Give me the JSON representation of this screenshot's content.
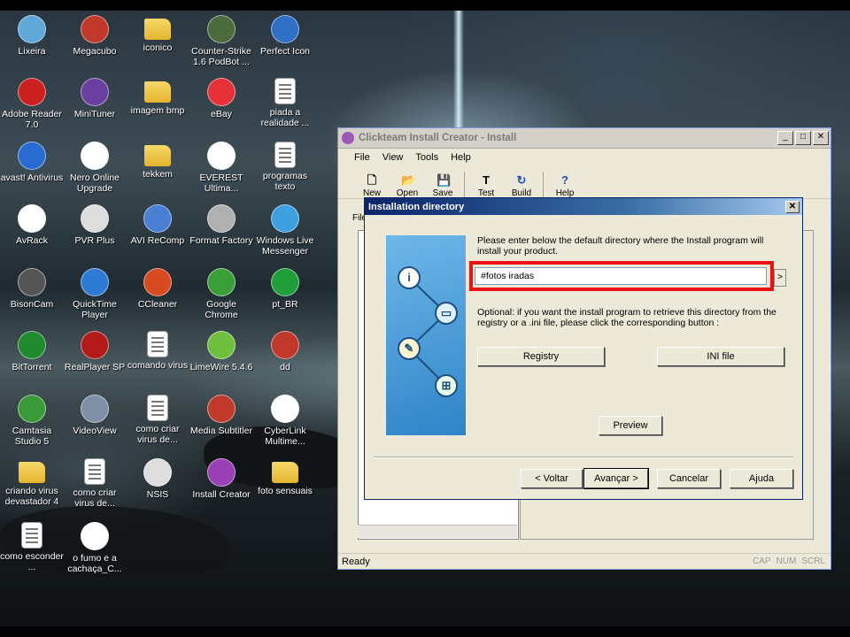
{
  "desktop": {
    "icons": [
      {
        "label": "Lixeira",
        "icon": "recycle-bin-icon",
        "color": "#5fa8d8"
      },
      {
        "label": "Megacubo",
        "icon": "megacubo-icon",
        "color": "#c0392b"
      },
      {
        "label": "iconico",
        "icon": "folder-icon",
        "color": "#e3b42c"
      },
      {
        "label": "Counter-Strike 1.6 PodBot ...",
        "icon": "counter-strike-icon",
        "color": "#4d6b3c"
      },
      {
        "label": "Perfect Icon",
        "icon": "perfect-icon-icon",
        "color": "#2f6fc5"
      },
      {
        "label": "Adobe Reader 7.0",
        "icon": "adobe-reader-icon",
        "color": "#cc1f1f"
      },
      {
        "label": "MiniTuner",
        "icon": "minituner-icon",
        "color": "#6b3fa0"
      },
      {
        "label": "imagem bmp",
        "icon": "folder-icon",
        "color": "#e3b42c"
      },
      {
        "label": "eBay",
        "icon": "ebay-icon",
        "color": "#e53238"
      },
      {
        "label": "piada a realidade ...",
        "icon": "document-icon",
        "color": "#ffffff"
      },
      {
        "label": "avast! Antivirus",
        "icon": "avast-icon",
        "color": "#2a6bd1"
      },
      {
        "label": "Nero Online Upgrade",
        "icon": "nero-icon",
        "color": "#ffffff"
      },
      {
        "label": "tekkem",
        "icon": "folder-icon",
        "color": "#e3b42c"
      },
      {
        "label": "EVEREST Ultima...",
        "icon": "everest-icon",
        "color": "#ffffff"
      },
      {
        "label": "programas texto",
        "icon": "document-icon",
        "color": "#ffffff"
      },
      {
        "label": "AvRack",
        "icon": "avrack-icon",
        "color": "#ffffff"
      },
      {
        "label": "PVR Plus",
        "icon": "pvr-plus-icon",
        "color": "#dddddd"
      },
      {
        "label": "AVI ReComp",
        "icon": "avi-recomp-icon",
        "color": "#4a7fd4"
      },
      {
        "label": "Format Factory",
        "icon": "format-factory-icon",
        "color": "#b0b0b0"
      },
      {
        "label": "Windows Live Messenger",
        "icon": "messenger-icon",
        "color": "#3fa0e0"
      },
      {
        "label": "BisonCam",
        "icon": "bisoncam-icon",
        "color": "#555555"
      },
      {
        "label": "QuickTime Player",
        "icon": "quicktime-icon",
        "color": "#2e7bd6"
      },
      {
        "label": "CCleaner",
        "icon": "ccleaner-icon",
        "color": "#d84a1f"
      },
      {
        "label": "Google Chrome",
        "icon": "chrome-icon",
        "color": "#3a9f3a"
      },
      {
        "label": "pt_BR",
        "icon": "brazil-flag-icon",
        "color": "#1f9e3a"
      },
      {
        "label": "BitTorrent",
        "icon": "bittorrent-icon",
        "color": "#1f8a2e"
      },
      {
        "label": "RealPlayer SP",
        "icon": "realplayer-icon",
        "color": "#b31b1b"
      },
      {
        "label": "comando virus",
        "icon": "document-icon",
        "color": "#ffffff"
      },
      {
        "label": "LimeWire 5.4.6",
        "icon": "limewire-icon",
        "color": "#6fbf3f"
      },
      {
        "label": "dd",
        "icon": "dd-icon",
        "color": "#c0392b"
      },
      {
        "label": "Camtasia Studio 5",
        "icon": "camtasia-icon",
        "color": "#3a9a3a"
      },
      {
        "label": "VideoView",
        "icon": "videoview-icon",
        "color": "#7f8fa6"
      },
      {
        "label": "como criar virus de...",
        "icon": "document-icon",
        "color": "#ffffff"
      },
      {
        "label": "Media Subtitler",
        "icon": "media-subtitler-icon",
        "color": "#c0392b"
      },
      {
        "label": "CyberLink Multime...",
        "icon": "cyberlink-icon",
        "color": "#ffffff"
      },
      {
        "label": "criando virus devastador 4",
        "icon": "folder-icon",
        "color": "#e3b42c"
      },
      {
        "label": "como criar virus de...",
        "icon": "document-icon",
        "color": "#ffffff"
      },
      {
        "label": "NSIS",
        "icon": "nsis-icon",
        "color": "#dddddd"
      },
      {
        "label": "Install Creator",
        "icon": "install-creator-icon",
        "color": "#9b3fb5"
      },
      {
        "label": "foto sensuais",
        "icon": "folder-icon",
        "color": "#e3b42c"
      },
      {
        "label": "como esconder ...",
        "icon": "document-icon",
        "color": "#ffffff"
      },
      {
        "label": "o fumo e a cachaça_C...",
        "icon": "wmv-file-icon",
        "color": "#ffffff"
      }
    ]
  },
  "window": {
    "title": "Clickteam Install Creator - Install",
    "controls": {
      "minimize": "_",
      "maximize": "□",
      "close": "✕"
    },
    "menu": [
      "File",
      "View",
      "Tools",
      "Help"
    ],
    "toolbar": [
      {
        "label": "New",
        "icon": "new-document-icon",
        "glyph": "🗋"
      },
      {
        "label": "Open",
        "icon": "open-folder-icon",
        "glyph": "📂"
      },
      {
        "label": "Save",
        "icon": "save-disk-icon",
        "glyph": "💾"
      },
      {
        "label": "Test",
        "icon": "test-icon",
        "glyph": "T"
      },
      {
        "label": "Build",
        "icon": "build-icon",
        "glyph": "↻"
      },
      {
        "label": "Help",
        "icon": "help-icon",
        "glyph": "?"
      }
    ],
    "partial_tab_label": "File",
    "status": {
      "text": "Ready",
      "cap": "CAP",
      "num": "NUM",
      "scrl": "SCRL"
    }
  },
  "dialog": {
    "title": "Installation directory",
    "close": "✕",
    "instruction": "Please enter below the default directory where the Install program will install your product.",
    "directory_value": "#fotos iradas",
    "browse_label": ">",
    "optional_text": "Optional: if you want the install program to retrieve this directory from the registry or a .ini file, please click the corresponding button :",
    "registry_button": "Registry",
    "ini_button": "INI file",
    "preview_button": "Preview",
    "back_button": "< Voltar",
    "next_button": "Avançar >",
    "cancel_button": "Cancelar",
    "help_button": "Ajuda",
    "highlight_color": "#ee1111",
    "graphic_nodes": [
      "info-icon",
      "computer-icon",
      "crayons-icon",
      "windows-icon"
    ]
  }
}
